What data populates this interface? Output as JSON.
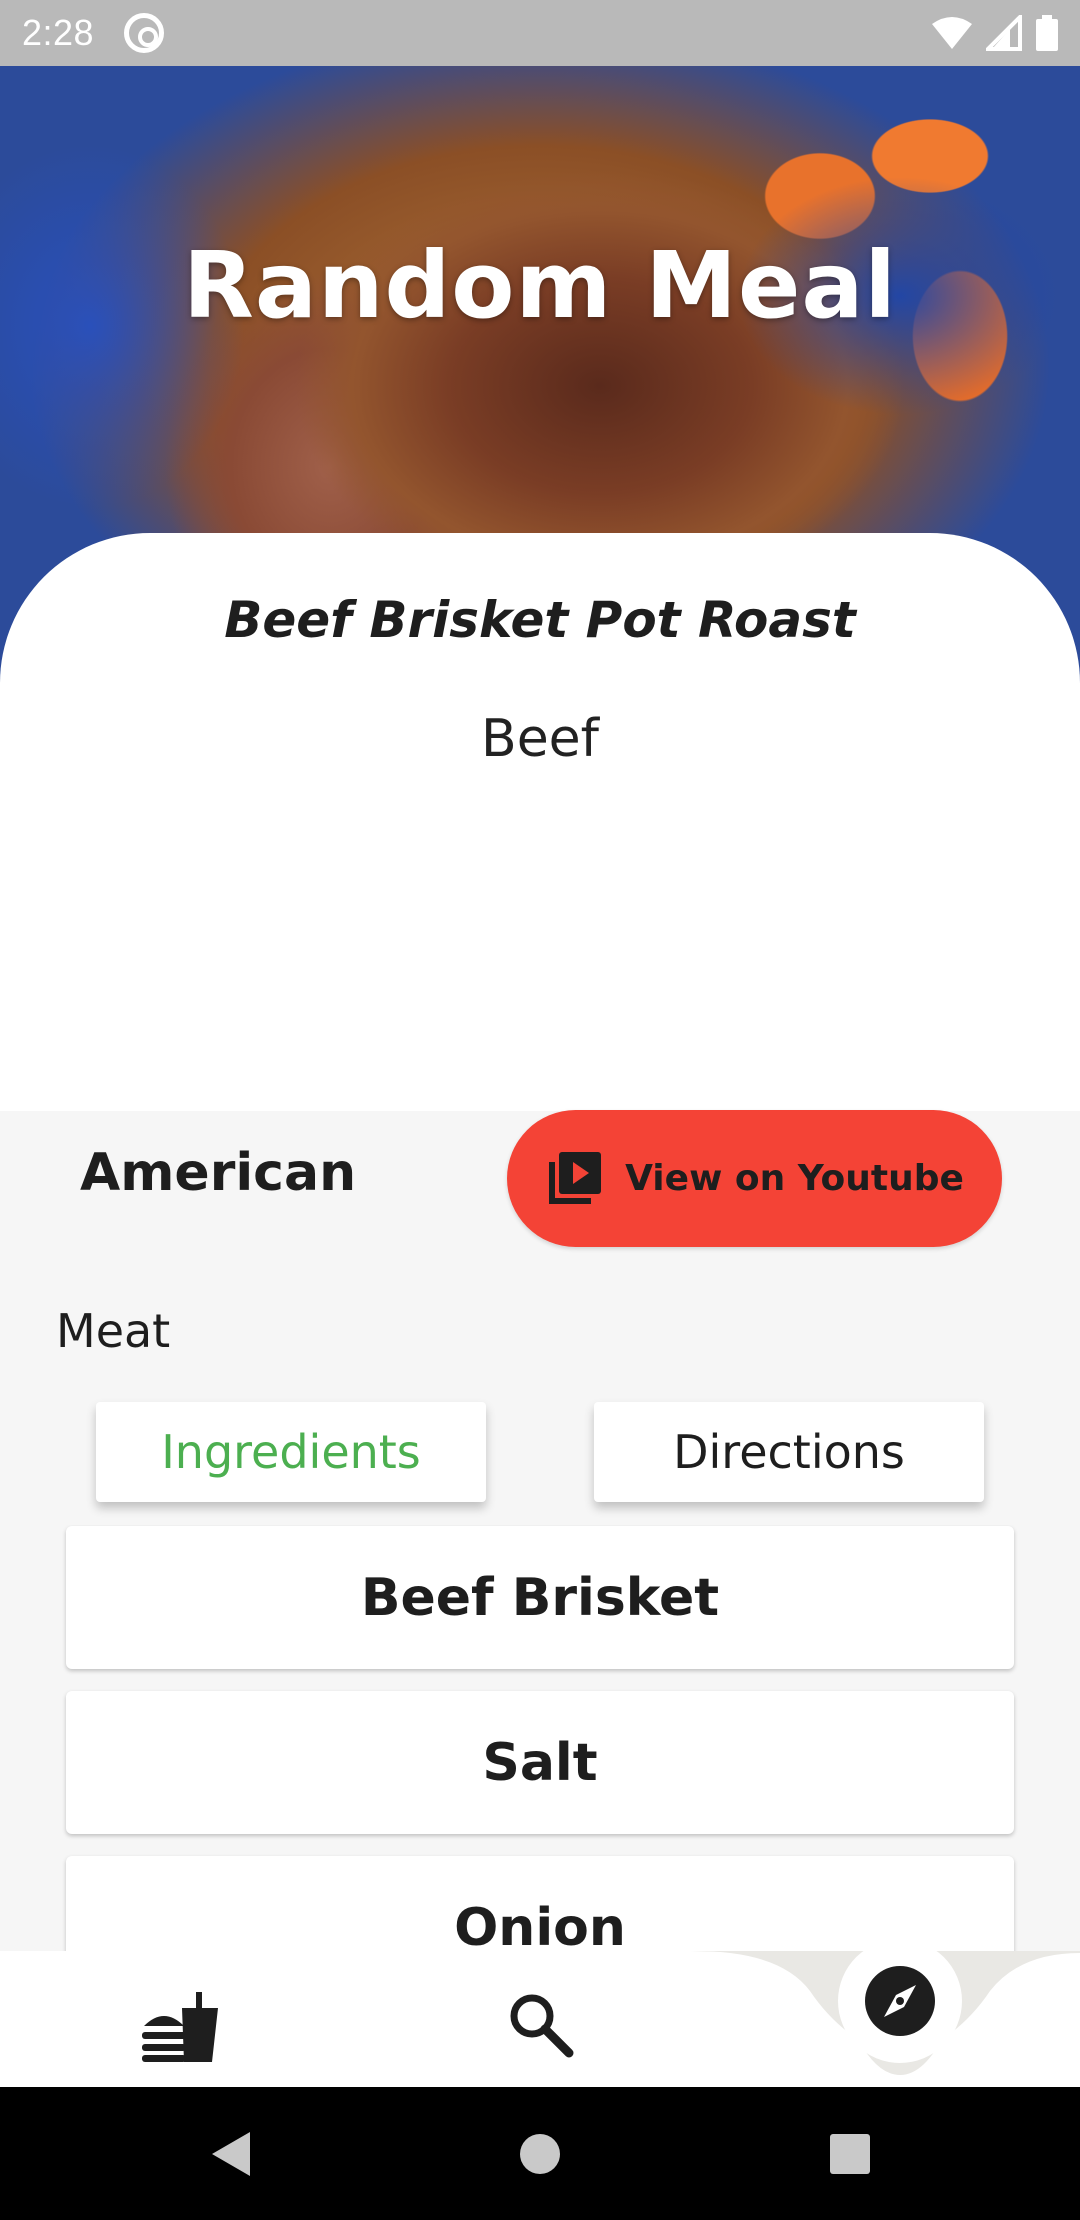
{
  "status_bar": {
    "time": "2:28"
  },
  "hero": {
    "title": "Random Meal"
  },
  "meal": {
    "name": "Beef Brisket Pot Roast",
    "category": "Beef",
    "area": "American",
    "tag": "Meat",
    "youtube_label": "View on Youtube"
  },
  "tabs": {
    "ingredients_label": "Ingredients",
    "directions_label": "Directions",
    "active": "ingredients"
  },
  "ingredients": [
    "Beef Brisket",
    "Salt",
    "Onion"
  ],
  "bottom_nav": {
    "items": [
      {
        "icon": "fastfood-icon"
      },
      {
        "icon": "search-icon"
      },
      {
        "icon": "compass-icon"
      }
    ]
  },
  "colors": {
    "youtube_red": "#f44336",
    "active_tab_green": "#4caf50",
    "status_bar": "#b9b9b9"
  }
}
